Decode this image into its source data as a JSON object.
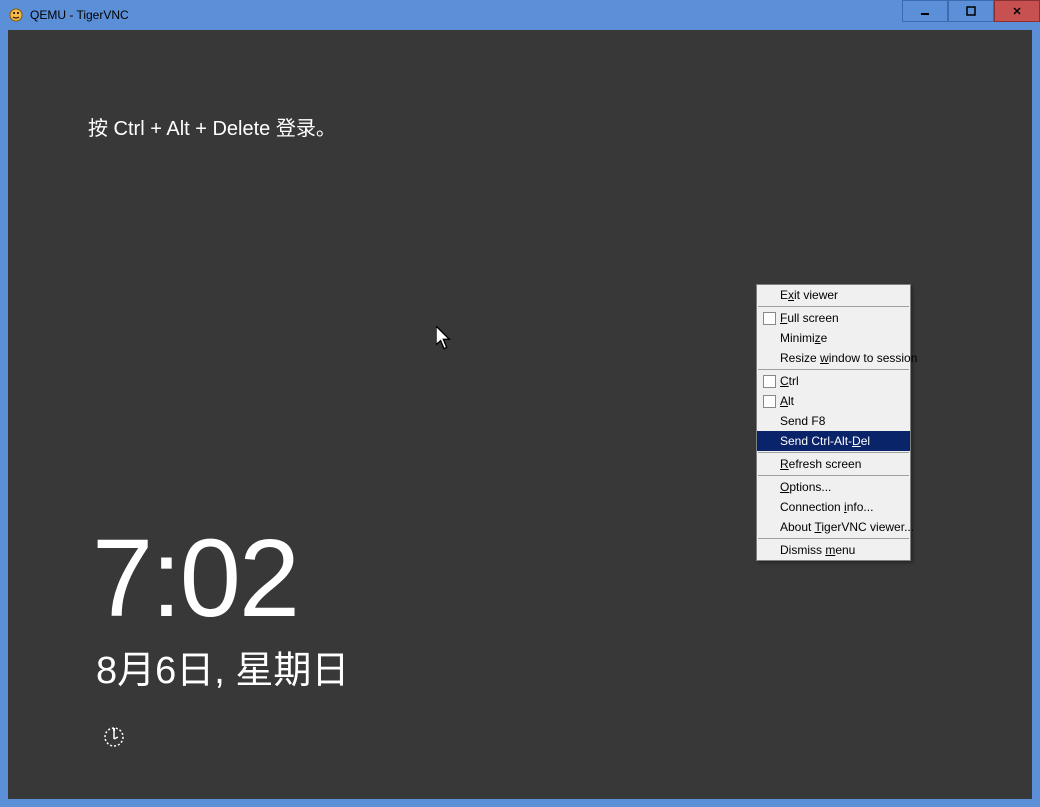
{
  "window": {
    "title": "QEMU - TigerVNC"
  },
  "lockscreen": {
    "instruction": "按 Ctrl + Alt + Delete 登录。",
    "time": "7:02",
    "date": "8月6日, 星期日"
  },
  "menu": {
    "exit_viewer": "Exit viewer",
    "full_screen": "Full screen",
    "minimize": "Minimize",
    "resize_window": "Resize window to session",
    "ctrl": "Ctrl",
    "alt": "Alt",
    "send_f8": "Send F8",
    "send_cad": "Send Ctrl-Alt-Del",
    "refresh": "Refresh screen",
    "options": "Options...",
    "conn_info": "Connection info...",
    "about": "About TigerVNC viewer...",
    "dismiss": "Dismiss menu"
  }
}
